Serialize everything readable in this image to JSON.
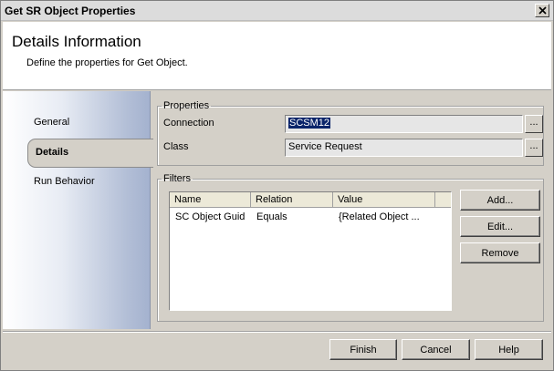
{
  "window": {
    "title": "Get SR Object Properties",
    "close_glyph": "✕"
  },
  "header": {
    "heading": "Details Information",
    "subheading": "Define the properties for Get Object."
  },
  "nav": {
    "items": [
      {
        "label": "General"
      },
      {
        "label": "Details",
        "selected": true
      },
      {
        "label": "Run Behavior"
      }
    ]
  },
  "properties": {
    "legend": "Properties",
    "connection_label": "Connection",
    "connection_value": "SCSM12",
    "class_label": "Class",
    "class_value": "Service Request",
    "browse_label": "..."
  },
  "filters": {
    "legend": "Filters",
    "columns": [
      "Name",
      "Relation",
      "Value"
    ],
    "rows": [
      {
        "name": "SC Object Guid",
        "relation": "Equals",
        "value": "{Related Object ..."
      }
    ],
    "add_label": "Add...",
    "edit_label": "Edit...",
    "remove_label": "Remove"
  },
  "footer": {
    "finish_label": "Finish",
    "cancel_label": "Cancel",
    "help_label": "Help"
  }
}
